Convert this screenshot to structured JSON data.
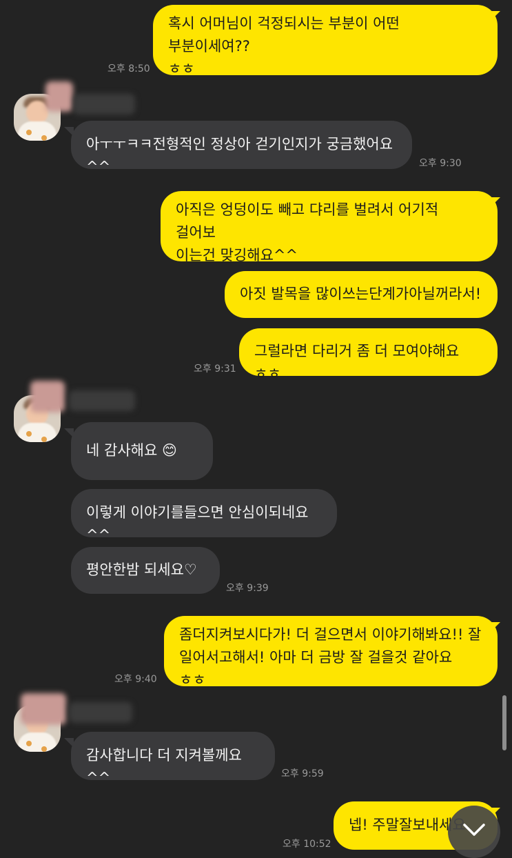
{
  "colors": {
    "background": "#232323",
    "my_bubble": "#FEE500",
    "their_bubble": "#3a3a3c",
    "timestamp": "#9a9a9a"
  },
  "messages": [
    {
      "sender": "me",
      "text": "혹시 어머님이 걱정되시는 부분이 어떤 부분이세여??\nㅎㅎ",
      "time": "오후 8:50"
    },
    {
      "sender": "them",
      "text": "아ㅜㅜㅋㅋ전형적인 정상아 걷기인지가 궁금했어요^^",
      "time": "오후 9:30"
    },
    {
      "sender": "me",
      "text": "아직은 엉덩이도 빼고 댜리를 벌려서 어기적 걸어보\n이는건 맞깅해요^^",
      "time": ""
    },
    {
      "sender": "me",
      "text": "아짓 발목을 많이쓰는단계가아닐꺼라서!",
      "time": ""
    },
    {
      "sender": "me",
      "text": "그럴라면 다리거 좀 더 모여야해요 ㅎㅎ",
      "time": "오후 9:31"
    },
    {
      "sender": "them",
      "text": "네 감사해요 😊",
      "time": ""
    },
    {
      "sender": "them",
      "text": "이렇게 이야기를들으면 안심이되네요^^",
      "time": ""
    },
    {
      "sender": "them",
      "text": "평안한밤 되세요♡",
      "time": "오후 9:39"
    },
    {
      "sender": "me",
      "text": "좀더지켜보시다가! 더 걸으면서 이야기해봐요!! 잘\n일어서고해서! 아마 더 금방 잘 걸을것 같아요 ㅎㅎ",
      "time": "오후 9:40"
    },
    {
      "sender": "them",
      "text": "감사합니다 더 지켜볼께요^^",
      "time": "오후 9:59"
    },
    {
      "sender": "me",
      "text": "넵! 주말잘보내세요",
      "time": "오후 10:52"
    }
  ],
  "icons": {
    "avatar": "avatar-icon",
    "scroll_to_bottom": "chevron-down-icon"
  }
}
